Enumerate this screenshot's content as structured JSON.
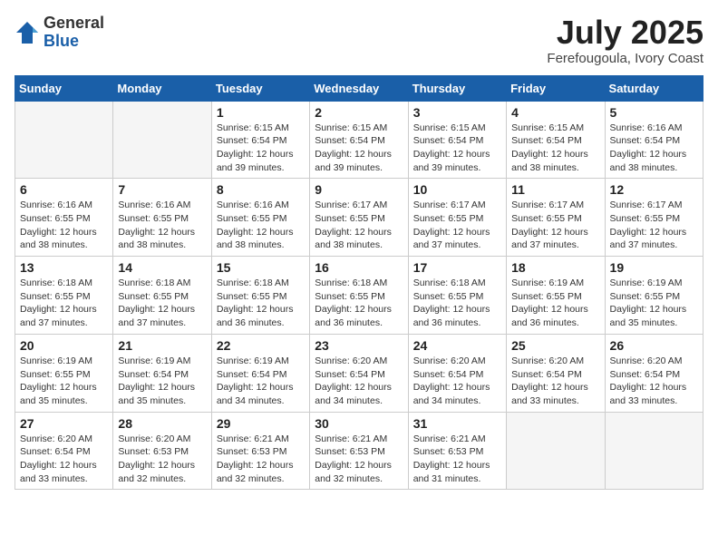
{
  "header": {
    "logo_general": "General",
    "logo_blue": "Blue",
    "month_year": "July 2025",
    "location": "Ferefougoula, Ivory Coast"
  },
  "calendar": {
    "days_of_week": [
      "Sunday",
      "Monday",
      "Tuesday",
      "Wednesday",
      "Thursday",
      "Friday",
      "Saturday"
    ],
    "weeks": [
      [
        {
          "day": "",
          "info": ""
        },
        {
          "day": "",
          "info": ""
        },
        {
          "day": "1",
          "info": "Sunrise: 6:15 AM\nSunset: 6:54 PM\nDaylight: 12 hours\nand 39 minutes."
        },
        {
          "day": "2",
          "info": "Sunrise: 6:15 AM\nSunset: 6:54 PM\nDaylight: 12 hours\nand 39 minutes."
        },
        {
          "day": "3",
          "info": "Sunrise: 6:15 AM\nSunset: 6:54 PM\nDaylight: 12 hours\nand 39 minutes."
        },
        {
          "day": "4",
          "info": "Sunrise: 6:15 AM\nSunset: 6:54 PM\nDaylight: 12 hours\nand 38 minutes."
        },
        {
          "day": "5",
          "info": "Sunrise: 6:16 AM\nSunset: 6:54 PM\nDaylight: 12 hours\nand 38 minutes."
        }
      ],
      [
        {
          "day": "6",
          "info": "Sunrise: 6:16 AM\nSunset: 6:55 PM\nDaylight: 12 hours\nand 38 minutes."
        },
        {
          "day": "7",
          "info": "Sunrise: 6:16 AM\nSunset: 6:55 PM\nDaylight: 12 hours\nand 38 minutes."
        },
        {
          "day": "8",
          "info": "Sunrise: 6:16 AM\nSunset: 6:55 PM\nDaylight: 12 hours\nand 38 minutes."
        },
        {
          "day": "9",
          "info": "Sunrise: 6:17 AM\nSunset: 6:55 PM\nDaylight: 12 hours\nand 38 minutes."
        },
        {
          "day": "10",
          "info": "Sunrise: 6:17 AM\nSunset: 6:55 PM\nDaylight: 12 hours\nand 37 minutes."
        },
        {
          "day": "11",
          "info": "Sunrise: 6:17 AM\nSunset: 6:55 PM\nDaylight: 12 hours\nand 37 minutes."
        },
        {
          "day": "12",
          "info": "Sunrise: 6:17 AM\nSunset: 6:55 PM\nDaylight: 12 hours\nand 37 minutes."
        }
      ],
      [
        {
          "day": "13",
          "info": "Sunrise: 6:18 AM\nSunset: 6:55 PM\nDaylight: 12 hours\nand 37 minutes."
        },
        {
          "day": "14",
          "info": "Sunrise: 6:18 AM\nSunset: 6:55 PM\nDaylight: 12 hours\nand 37 minutes."
        },
        {
          "day": "15",
          "info": "Sunrise: 6:18 AM\nSunset: 6:55 PM\nDaylight: 12 hours\nand 36 minutes."
        },
        {
          "day": "16",
          "info": "Sunrise: 6:18 AM\nSunset: 6:55 PM\nDaylight: 12 hours\nand 36 minutes."
        },
        {
          "day": "17",
          "info": "Sunrise: 6:18 AM\nSunset: 6:55 PM\nDaylight: 12 hours\nand 36 minutes."
        },
        {
          "day": "18",
          "info": "Sunrise: 6:19 AM\nSunset: 6:55 PM\nDaylight: 12 hours\nand 36 minutes."
        },
        {
          "day": "19",
          "info": "Sunrise: 6:19 AM\nSunset: 6:55 PM\nDaylight: 12 hours\nand 35 minutes."
        }
      ],
      [
        {
          "day": "20",
          "info": "Sunrise: 6:19 AM\nSunset: 6:55 PM\nDaylight: 12 hours\nand 35 minutes."
        },
        {
          "day": "21",
          "info": "Sunrise: 6:19 AM\nSunset: 6:54 PM\nDaylight: 12 hours\nand 35 minutes."
        },
        {
          "day": "22",
          "info": "Sunrise: 6:19 AM\nSunset: 6:54 PM\nDaylight: 12 hours\nand 34 minutes."
        },
        {
          "day": "23",
          "info": "Sunrise: 6:20 AM\nSunset: 6:54 PM\nDaylight: 12 hours\nand 34 minutes."
        },
        {
          "day": "24",
          "info": "Sunrise: 6:20 AM\nSunset: 6:54 PM\nDaylight: 12 hours\nand 34 minutes."
        },
        {
          "day": "25",
          "info": "Sunrise: 6:20 AM\nSunset: 6:54 PM\nDaylight: 12 hours\nand 33 minutes."
        },
        {
          "day": "26",
          "info": "Sunrise: 6:20 AM\nSunset: 6:54 PM\nDaylight: 12 hours\nand 33 minutes."
        }
      ],
      [
        {
          "day": "27",
          "info": "Sunrise: 6:20 AM\nSunset: 6:54 PM\nDaylight: 12 hours\nand 33 minutes."
        },
        {
          "day": "28",
          "info": "Sunrise: 6:20 AM\nSunset: 6:53 PM\nDaylight: 12 hours\nand 32 minutes."
        },
        {
          "day": "29",
          "info": "Sunrise: 6:21 AM\nSunset: 6:53 PM\nDaylight: 12 hours\nand 32 minutes."
        },
        {
          "day": "30",
          "info": "Sunrise: 6:21 AM\nSunset: 6:53 PM\nDaylight: 12 hours\nand 32 minutes."
        },
        {
          "day": "31",
          "info": "Sunrise: 6:21 AM\nSunset: 6:53 PM\nDaylight: 12 hours\nand 31 minutes."
        },
        {
          "day": "",
          "info": ""
        },
        {
          "day": "",
          "info": ""
        }
      ]
    ]
  }
}
